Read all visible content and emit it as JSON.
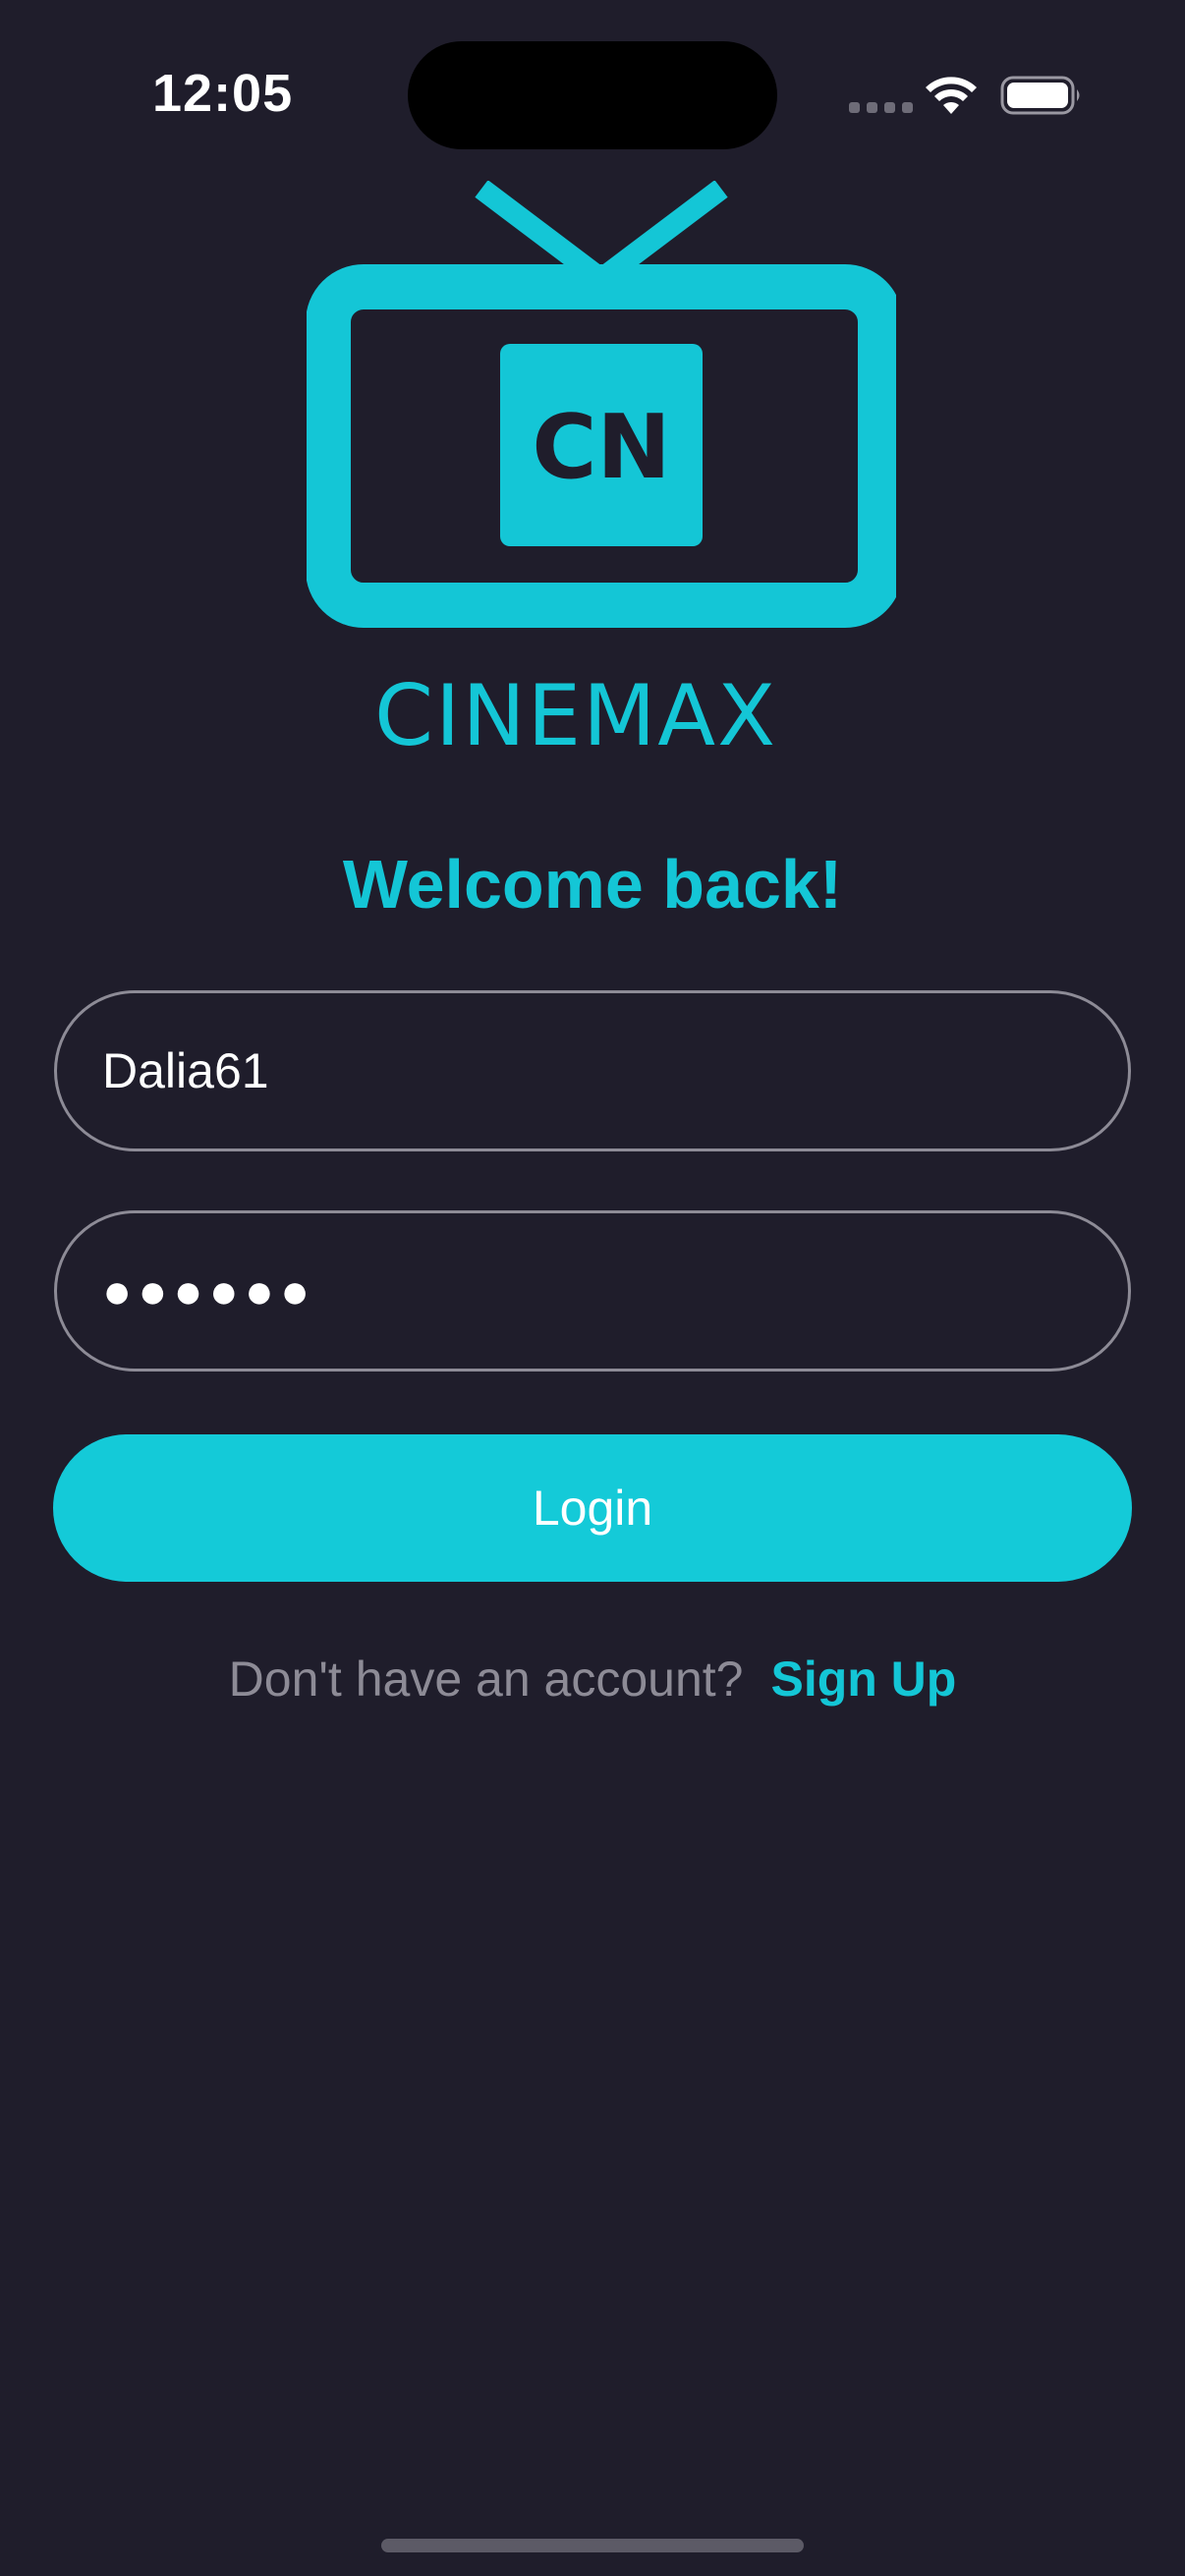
{
  "status_bar": {
    "time": "12:05"
  },
  "logo": {
    "monogram": "CN",
    "wordmark": "CINEMAX"
  },
  "login": {
    "welcome": "Welcome back!",
    "username_value": "Dalia61",
    "password_value": "●●●●●●",
    "login_label": "Login",
    "signup_prompt": "Don't have an account?",
    "signup_link": "Sign Up"
  },
  "colors": {
    "background": "#1f1d2b",
    "accent": "#14c6d6",
    "muted_text": "#8d8b96",
    "field_border": "#8d8b96"
  },
  "icons": {
    "wifi": "wifi-icon",
    "battery": "battery-icon",
    "logo": "tv-logo-icon"
  }
}
